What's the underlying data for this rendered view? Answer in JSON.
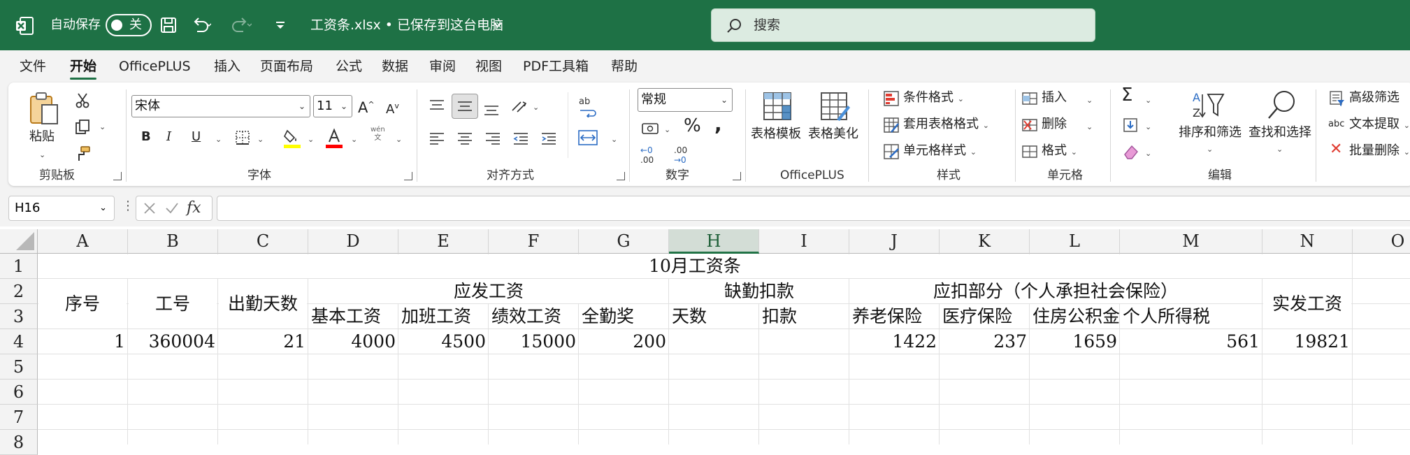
{
  "titlebar": {
    "autosave_label": "自动保存",
    "toggle_state": "关",
    "filename": "工资条.xlsx • 已保存到这台电脑",
    "search_placeholder": "搜索"
  },
  "tabs": [
    "文件",
    "开始",
    "OfficePLUS",
    "插入",
    "页面布局",
    "公式",
    "数据",
    "审阅",
    "视图",
    "PDF工具箱",
    "帮助"
  ],
  "active_tab": "开始",
  "ribbon": {
    "clipboard": {
      "label": "剪贴板",
      "paste": "粘贴"
    },
    "font": {
      "label": "字体",
      "font_name": "宋体",
      "font_size": "11",
      "pinyin": "wén"
    },
    "alignment": {
      "label": "对齐方式"
    },
    "number": {
      "label": "数字",
      "format": "常规",
      "inc": ".00",
      "dec": ".00"
    },
    "officeplus": {
      "label": "OfficePLUS",
      "table_template": "表格模板",
      "table_beautify": "表格美化"
    },
    "styles": {
      "label": "样式",
      "conditional": "条件格式",
      "table_format": "套用表格格式",
      "cell_style": "单元格样式"
    },
    "cells": {
      "label": "单元格",
      "insert": "插入",
      "delete": "删除",
      "format": "格式"
    },
    "editing": {
      "label": "编辑",
      "sort_filter": "排序和筛选",
      "find_select": "查找和选择"
    },
    "extra": {
      "advanced_filter": "高级筛选",
      "text_extract": "文本提取",
      "batch_delete": "批量删除"
    }
  },
  "formula_bar": {
    "name_box": "H16",
    "fx": "fx",
    "formula": ""
  },
  "columns": [
    "A",
    "B",
    "C",
    "D",
    "E",
    "F",
    "G",
    "H",
    "I",
    "J",
    "K",
    "L",
    "M",
    "N",
    "O"
  ],
  "selected_column": "H",
  "rows": [
    "1",
    "2",
    "3",
    "4",
    "5",
    "6",
    "7",
    "8"
  ],
  "sheet": {
    "title": "10月工资条",
    "seq": "序号",
    "emp_id": "工号",
    "attendance": "出勤天数",
    "payable": "应发工资",
    "absence": "缺勤扣款",
    "deductions": "应扣部分（个人承担社会保险）",
    "net_pay": "实发工资",
    "base": "基本工资",
    "overtime": "加班工资",
    "performance": "绩效工资",
    "full_attendance": "全勤奖",
    "days": "天数",
    "deduct": "扣款",
    "pension": "养老保险",
    "medical": "医疗保险",
    "housing": "住房公积金",
    "income_tax": "个人所得税",
    "values": {
      "seq": "1",
      "emp_id": "360004",
      "attendance": "21",
      "base": "4000",
      "overtime": "4500",
      "performance": "15000",
      "full_attendance": "200",
      "pension": "1422",
      "medical": "237",
      "housing": "1659",
      "income_tax": "561",
      "net_pay": "19821"
    }
  }
}
